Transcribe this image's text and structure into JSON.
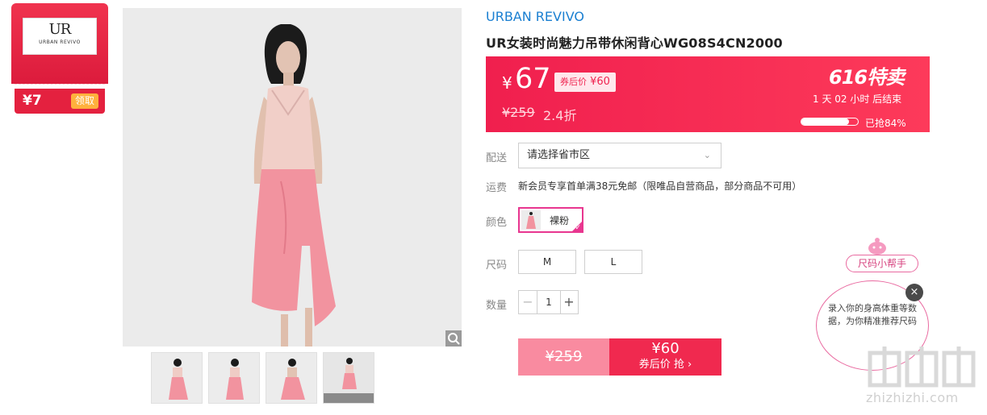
{
  "coupon": {
    "logo_text": "UR",
    "logo_sub": "URBAN REVIVO",
    "amount": "¥7",
    "claim_label": "领取"
  },
  "product": {
    "brand": "URBAN REVIVO",
    "title": "UR女装时尚魅力吊带休闲背心WG08S4CN2000",
    "currency": "¥",
    "price": "67",
    "after_coupon_prefix": "券后价",
    "after_coupon_price": "¥60",
    "original_price": "¥259",
    "discount": "2.4折",
    "sale_badge": "616特卖",
    "countdown": "1 天 02 小时 后结束",
    "grabbed_label": "已抢84%",
    "grabbed_fraction": 0.84
  },
  "options": {
    "shipping_label": "配送",
    "shipping_select": "请选择省市区",
    "freight_label": "运费",
    "freight_text": "新会员专享首单满38元免邮（限唯品自营商品，部分商品不可用）",
    "color_label": "颜色",
    "color_value": "裸粉",
    "size_label": "尺码",
    "sizes": [
      "M",
      "L"
    ],
    "qty_label": "数量",
    "qty_value": "1",
    "qty_minus": "−",
    "qty_plus": "+"
  },
  "buy": {
    "orig_price": "¥259",
    "price": "¥60",
    "cta": "券后价 抢 ›"
  },
  "helper": {
    "tag": "尺码小帮手",
    "text": "录入你的身高体重等数据，为你精准推荐尺码",
    "close": "×"
  },
  "watermark": {
    "domain": "zhizhizhi.com"
  },
  "colors": {
    "accent": "#f0234f",
    "brand_blue": "#1a7fd1",
    "helper_pink": "#e96aa0"
  }
}
